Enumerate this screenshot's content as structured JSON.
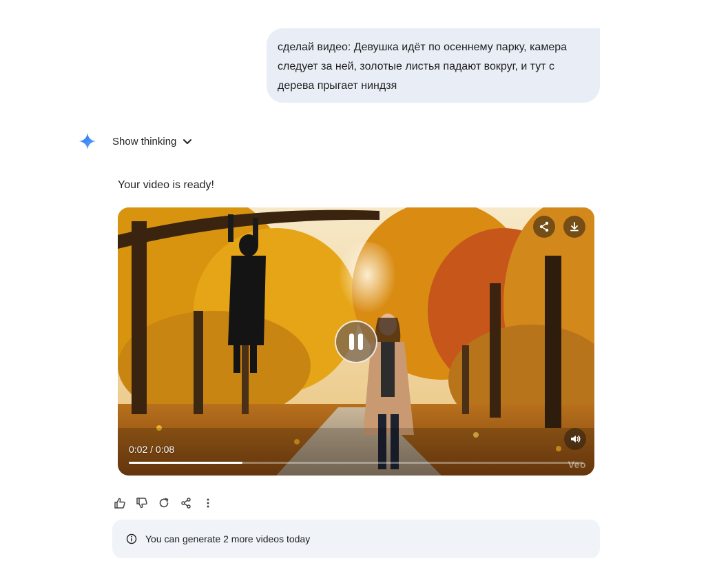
{
  "user_prompt": {
    "line1": "сделай видео: Девушка идёт по осеннему парку, камера",
    "line2": "следует за ней, золотые листья падают вокруг, и тут с",
    "line3": "дерева прыгает ниндзя"
  },
  "model": {
    "show_thinking_label": "Show thinking",
    "ready_text": "Your video is ready!",
    "icon": "gemini-spark-icon"
  },
  "video": {
    "time_label": "0:02 / 0:08",
    "current_seconds": 2,
    "duration_seconds": 8,
    "watermark": "Veo",
    "state": "playing",
    "controls": [
      "share-icon",
      "download-icon",
      "pause-icon",
      "volume-icon"
    ]
  },
  "actions": [
    "thumb-up-icon",
    "thumb-down-icon",
    "regenerate-icon",
    "share-icon",
    "more-vert-icon"
  ],
  "info_banner": {
    "text": "You can generate 2 more videos today",
    "icon": "info-icon"
  },
  "colors": {
    "bubble_bg": "#e9eef6",
    "banner_bg": "#f0f4f9",
    "accent_blue": "#4285f4"
  }
}
